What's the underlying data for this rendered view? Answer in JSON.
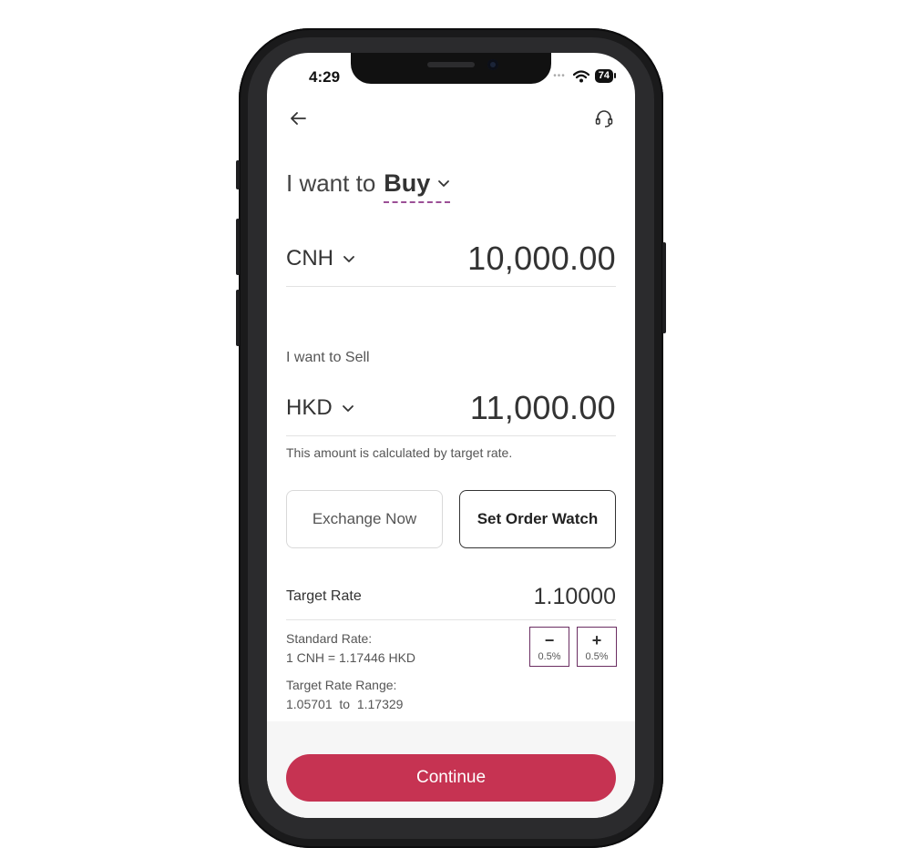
{
  "status_bar": {
    "time": "4:29",
    "battery": "74"
  },
  "nav": {
    "back_icon": "arrow-left-icon",
    "support_icon": "headset-icon"
  },
  "buy": {
    "lead": "I want to",
    "action": "Buy",
    "currency": "CNH",
    "amount": "10,000.00"
  },
  "sell": {
    "label": "I want to Sell",
    "currency": "HKD",
    "amount": "11,000.00",
    "note": "This amount is calculated by target rate."
  },
  "modes": {
    "exchange_now": "Exchange Now",
    "order_watch": "Set Order Watch",
    "selected": "order_watch"
  },
  "target": {
    "label": "Target Rate",
    "value": "1.10000"
  },
  "standard": {
    "label": "Standard Rate:",
    "value": "1 CNH = 1.17446 HKD"
  },
  "range": {
    "label": "Target Rate Range:",
    "value": "1.05701  to  1.17329"
  },
  "steppers": {
    "minus_symbol": "−",
    "plus_symbol": "+",
    "step": "0.5%"
  },
  "cta": {
    "label": "Continue"
  },
  "colors": {
    "accent": "#c63352",
    "brand_purple": "#6b2e62",
    "dash_underline": "#9b4f96"
  }
}
